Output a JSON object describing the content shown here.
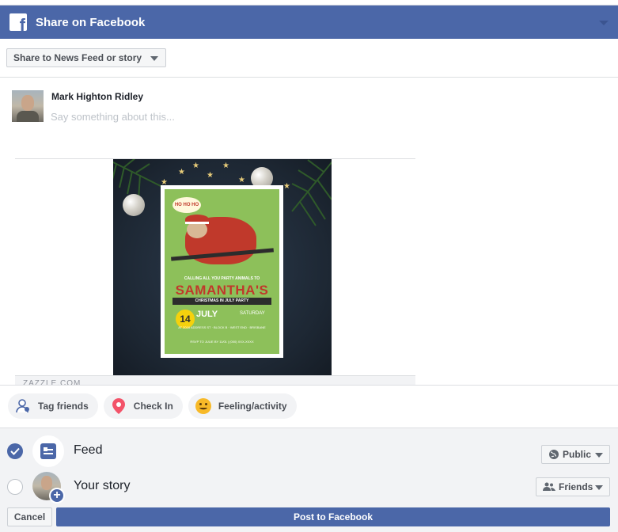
{
  "header": {
    "title": "Share on Facebook",
    "logo_letter": "f",
    "logo_icon": "facebook-logo-icon",
    "chevron_icon": "chevron-down-icon"
  },
  "share_target": {
    "label": "Share to News Feed or story"
  },
  "composer": {
    "user_name": "Mark Highton Ridley",
    "placeholder": "Say something about this..."
  },
  "preview": {
    "domain": "ZAZZLE.COM",
    "card": {
      "bubble": "HO HO HO",
      "tagline": "CALLING ALL YOU PARTY ANIMALS TO",
      "name": "SAMANTHA'S",
      "ribbon": "CHRISTMAS IN JULY PARTY",
      "day": "14",
      "month": "JULY",
      "weekday": "SATURDAY",
      "address": "AT 2016 ADDRESS ST · BLOCK B · WEST END · BRISBANE",
      "rsvp": "RSVP TO JULIE BY 11/01 | (000) XXX-XXXX"
    }
  },
  "actions": [
    {
      "label": "Tag friends",
      "icon": "tag-friends-icon"
    },
    {
      "label": "Check In",
      "icon": "location-pin-icon"
    },
    {
      "label": "Feeling/activity",
      "icon": "smiley-icon"
    }
  ],
  "destinations": {
    "feed": {
      "label": "Feed",
      "selected": true,
      "audience": "Public",
      "audience_icon": "globe-icon"
    },
    "story": {
      "label": "Your story",
      "selected": false,
      "audience": "Friends",
      "audience_icon": "friends-icon"
    }
  },
  "footer": {
    "cancel_label": "Cancel",
    "post_label": "Post to Facebook"
  },
  "colors": {
    "brand": "#4b67a8",
    "panel": "#f2f3f5",
    "text": "#1d2129",
    "muted": "#4b4f56"
  }
}
